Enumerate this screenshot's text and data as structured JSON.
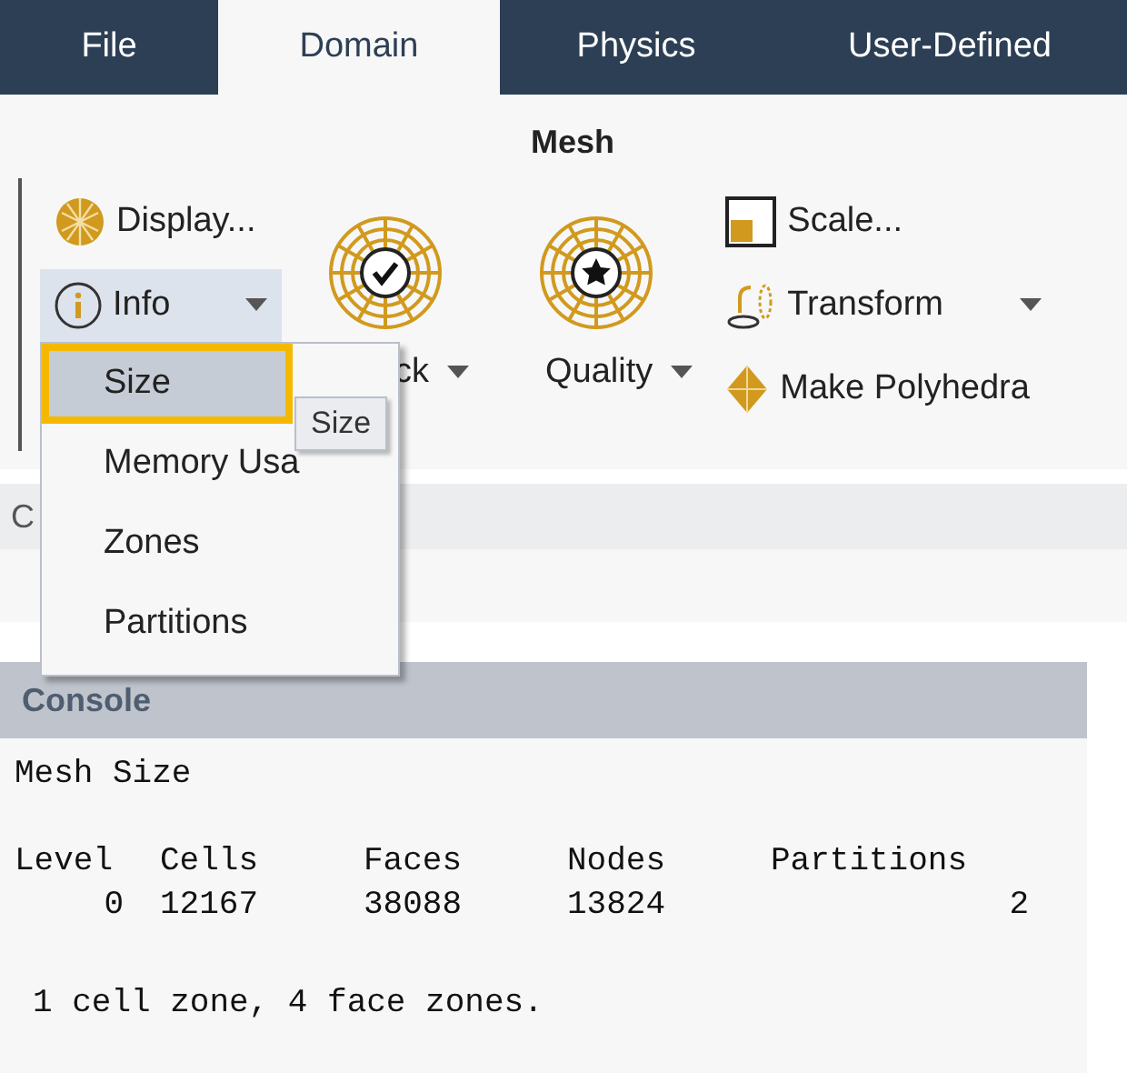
{
  "tabs": [
    {
      "label": "File",
      "selected": false
    },
    {
      "label": "Domain",
      "selected": true
    },
    {
      "label": "Physics",
      "selected": false
    },
    {
      "label": "User-Defined",
      "selected": false
    }
  ],
  "ribbon": {
    "group_title": "Mesh",
    "display_button": "Display...",
    "info_button": {
      "label": "Info",
      "expanded": true
    },
    "check_button": "ck",
    "quality_button": "Quality",
    "scale_button": "Scale...",
    "transform_button": "Transform",
    "polyhedra_button": "Make Polyhedra"
  },
  "info_menu": {
    "items": [
      {
        "label": "Size",
        "selected": true
      },
      {
        "label": "Memory Usa",
        "selected": false
      },
      {
        "label": "Zones",
        "selected": false
      },
      {
        "label": "Partitions",
        "selected": false
      }
    ],
    "tooltip": "Size"
  },
  "hidden_panel": {
    "title": "C"
  },
  "console": {
    "title": "Console",
    "heading": "Mesh Size",
    "columns": [
      "Level",
      "Cells",
      "Faces",
      "Nodes",
      "Partitions"
    ],
    "rows": [
      [
        "0",
        "12167",
        "38088",
        "13824",
        "2"
      ]
    ],
    "summary": "1 cell zone, 4 face zones."
  }
}
